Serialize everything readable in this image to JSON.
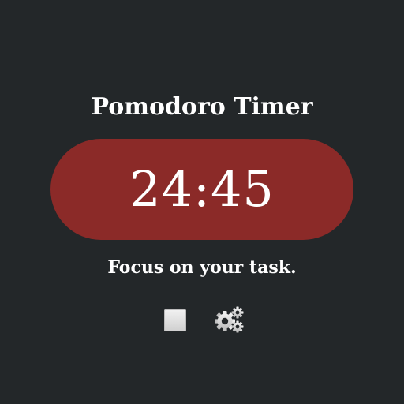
{
  "app": {
    "title": "Pomodoro Timer",
    "timer_display": "24:45",
    "status_message": "Focus on your task."
  },
  "controls": {
    "stop_icon": "stop-square-icon",
    "settings_icon": "gears-icon"
  },
  "colors": {
    "background": "#232729",
    "timer_pill": "#8b2a28",
    "text": "#ffffff"
  }
}
